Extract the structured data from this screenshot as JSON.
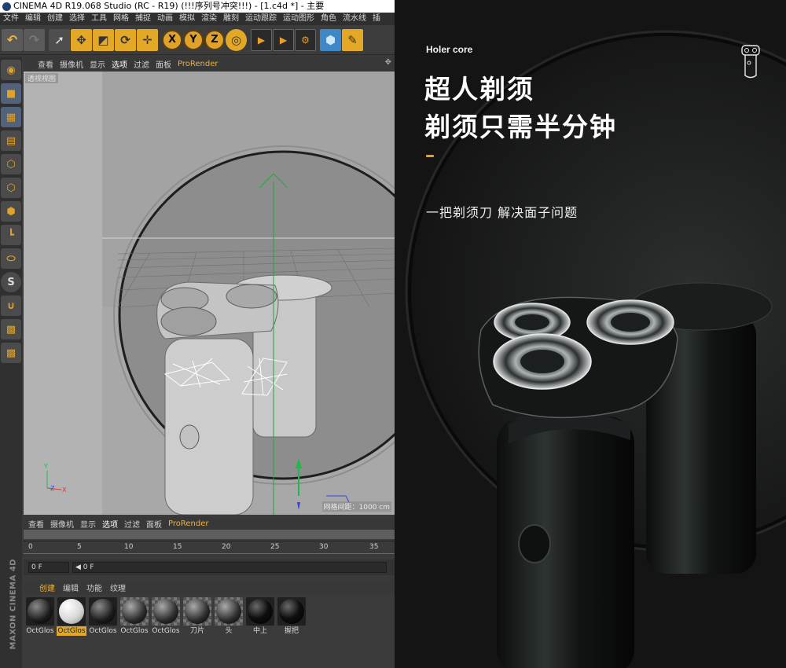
{
  "c4d": {
    "title": "CINEMA 4D R19.068 Studio (RC - R19) (!!!序列号冲突!!!) - [1.c4d *] - 主要",
    "menu": [
      "文件",
      "编辑",
      "创建",
      "选择",
      "工具",
      "网格",
      "捕捉",
      "动画",
      "模拟",
      "渲染",
      "雕刻",
      "运动跟踪",
      "运动图形",
      "角色",
      "流水线",
      "插"
    ],
    "axes": [
      "X",
      "Y",
      "Z"
    ],
    "viewport_menu": [
      "查看",
      "摄像机",
      "显示",
      "选项",
      "过滤",
      "面板",
      "ProRender"
    ],
    "viewport_label": "透视视图",
    "grid_info": "网格间距：1000 cm",
    "lower_menu": [
      "查看",
      "摄像机",
      "显示",
      "选项",
      "过滤",
      "面板",
      "ProRender"
    ],
    "timeline_ticks": [
      "0",
      "5",
      "10",
      "15",
      "20",
      "25",
      "30",
      "35"
    ],
    "frame_start": "0 F",
    "frame_current": "◀ 0 F",
    "material_menu": [
      "创建",
      "编辑",
      "功能",
      "纹理"
    ],
    "materials": [
      {
        "label": "OctGlos",
        "style": "dark"
      },
      {
        "label": "OctGlos",
        "style": "white",
        "selected": true
      },
      {
        "label": "OctGlos",
        "style": "dark"
      },
      {
        "label": "OctGlos",
        "style": "checker"
      },
      {
        "label": "OctGlos",
        "style": "checker"
      },
      {
        "label": "刀片",
        "style": "checker"
      },
      {
        "label": "头",
        "style": "checker"
      },
      {
        "label": "中上",
        "style": "black"
      },
      {
        "label": "握把",
        "style": "black"
      }
    ],
    "vendor_logo": "MAXON CINEMA 4D"
  },
  "render": {
    "brand": "Holer core",
    "headline_line1": "超人剃须",
    "headline_line2": "剃须只需半分钟",
    "subtitle": "一把剃须刀 解决面子问题",
    "accent_color": "#e8a321"
  }
}
